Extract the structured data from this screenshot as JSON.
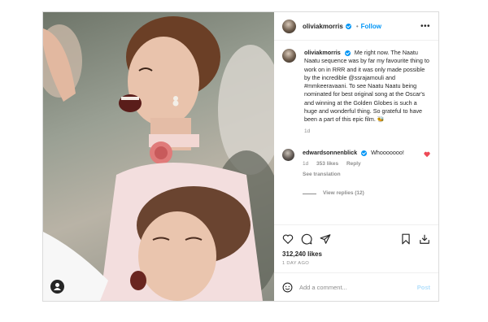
{
  "post": {
    "username": "oliviakmorris",
    "follow_label": "Follow",
    "separator": "•",
    "more_label": "•••",
    "caption": {
      "username": "oliviakmorris",
      "text": "Me right now. The Naatu Naatu sequence was by far my favourite thing to work on in RRR and it was only made possible by the incredible @ssrajamouli and #mmkeeravaani. To see Naatu Naatu being nominated for best original song at the Oscar's and winning at the Golden Globes is such a huge and wonderful thing. So grateful to have been a part of this epic film. 🐝",
      "time": "1d"
    },
    "comment": {
      "username": "edwardsonnenblick",
      "text": "Whooooooo!",
      "time": "1d",
      "likes": "353 likes",
      "reply": "Reply",
      "see_translation": "See translation",
      "view_replies": "View replies (12)"
    },
    "likes": "312,240 likes",
    "posted_ago": "1 DAY AGO",
    "add_comment_placeholder": "Add a comment...",
    "post_label": "Post"
  },
  "colors": {
    "accent": "#0095f6",
    "heart": "#ed4956",
    "muted": "#8e8e8e"
  },
  "icons": [
    "user-tag-icon",
    "verified-icon",
    "more-icon",
    "heart-icon",
    "comment-icon",
    "share-icon",
    "save-icon",
    "download-icon",
    "emoji-icon"
  ]
}
